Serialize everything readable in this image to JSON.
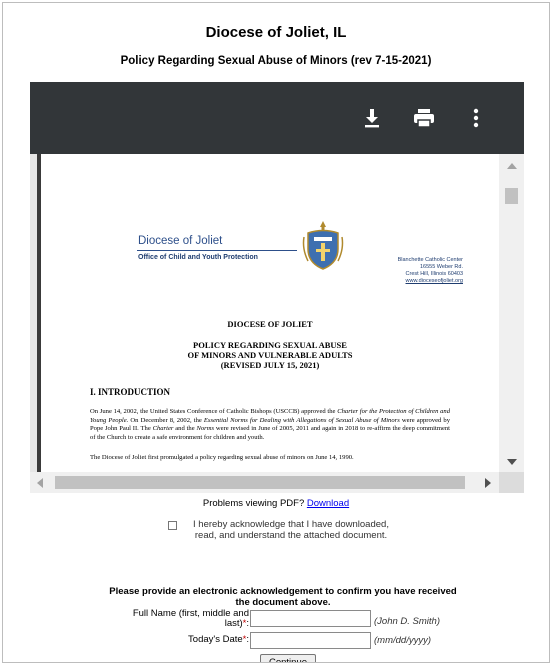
{
  "page": {
    "title": "Diocese of Joliet, IL",
    "subtitle": "Policy Regarding Sexual Abuse of Minors (rev 7-15-2021)"
  },
  "viewer": {
    "toolbar_icons": [
      "download-icon",
      "print-icon",
      "more-vert-icon"
    ],
    "document": {
      "letterhead_name": "Diocese of Joliet",
      "letterhead_office": "Office of Child and Youth Protection",
      "address_lines": [
        "Blanchette Catholic Center",
        "16555 Weber Rd.",
        "Crest Hill, Illinois 60403"
      ],
      "address_link": "www.dioceseofjoliet.org",
      "heading": "DIOCESE OF JOLIET",
      "policy_title_lines": [
        "POLICY REGARDING SEXUAL ABUSE",
        "OF MINORS AND VULNERABLE ADULTS",
        "(REVISED JULY 15, 2021)"
      ],
      "section_title": "I. INTRODUCTION",
      "para1_a": "On June 14, 2002, the United States Conference of Catholic Bishops (USCCB) approved the ",
      "para1_b": "Charter for the Protection of Children and Young People.",
      "para1_c": "  On December 8, 2002, the ",
      "para1_d": "Essential Norms for Dealing with Allegations of Sexual Abuse of Minors",
      "para1_e": " were approved by Pope John Paul II.  The ",
      "para1_f": "Charter",
      "para1_g": " and the ",
      "para1_h": "Norms",
      "para1_i": " were revised in June of 2005, 2011 and again in 2018 to re-affirm the deep commitment of the Church to create a safe environment for children and youth.",
      "para2": "The Diocese of Joliet first promulgated a policy regarding sexual abuse of minors on June 14, 1990."
    }
  },
  "problems": {
    "text": "Problems viewing PDF? ",
    "link": "Download"
  },
  "acknowledge": {
    "label": "I hereby acknowledge that I have downloaded, read, and understand the attached document.",
    "checked": false
  },
  "form": {
    "prompt": "Please provide an electronic acknowledgement to confirm you have received the document above.",
    "full_name_label_line1": "Full Name (first, middle and",
    "full_name_label_line2": "last)",
    "full_name_value": "",
    "full_name_hint": "(John D. Smith)",
    "date_label": "Today's Date",
    "date_value": "",
    "date_hint": "(mm/dd/yyyy)",
    "required_mark": "*",
    "colon": ":",
    "continue_label": "Continue"
  }
}
